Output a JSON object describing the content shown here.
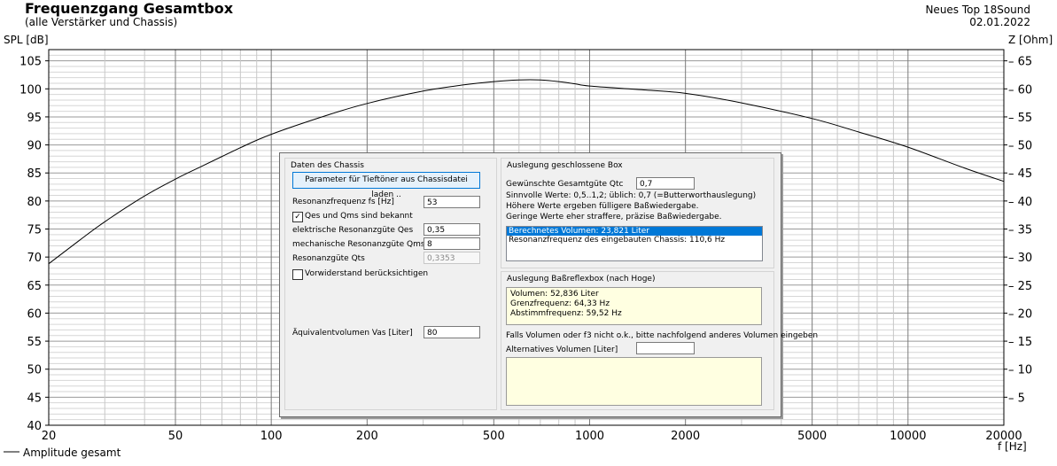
{
  "header": {
    "title": "Frequenzgang Gesamtbox",
    "subtitle": "(alle Verstärker und Chassis)",
    "project": "Neues Top 18Sound",
    "date": "02.01.2022"
  },
  "chart_data": {
    "type": "line",
    "title": "Frequenzgang Gesamtbox",
    "subtitle": "(alle Verstärker und Chassis)",
    "xlabel": "f [Hz]",
    "ylabel": "SPL [dB]",
    "y2label": "Z [Ohm]",
    "xscale": "log",
    "xlim": [
      20,
      20000
    ],
    "ylim": [
      40,
      107
    ],
    "y2lim": [
      0,
      67
    ],
    "grid": true,
    "x_ticks": [
      20,
      50,
      100,
      200,
      500,
      1000,
      2000,
      5000,
      10000,
      20000
    ],
    "x_tick_labels": [
      "20",
      "50",
      "100",
      "200",
      "500",
      "1000",
      "2000",
      "5000",
      "10000",
      "20000"
    ],
    "y_ticks": [
      40,
      45,
      50,
      55,
      60,
      65,
      70,
      75,
      80,
      85,
      90,
      95,
      100,
      105
    ],
    "y_tick_labels": [
      "40",
      "45",
      "50",
      "55",
      "60",
      "65",
      "70",
      "75",
      "80",
      "85",
      "90",
      "95",
      "100",
      "105"
    ],
    "y2_ticks": [
      5,
      10,
      15,
      20,
      25,
      30,
      35,
      40,
      45,
      50,
      55,
      60,
      65
    ],
    "y2_tick_labels": [
      "5",
      "10",
      "15",
      "20",
      "25",
      "30",
      "35",
      "40",
      "45",
      "50",
      "55",
      "60",
      "65"
    ],
    "legend": "bottom-left",
    "series": [
      {
        "name": "Amplitude gesamt",
        "color": "#000000",
        "x": [
          20,
          25,
          30,
          40,
          50,
          60,
          80,
          100,
          150,
          200,
          300,
          400,
          500,
          600,
          700,
          800,
          900,
          1000,
          1500,
          2000,
          3000,
          5000,
          7000,
          10000,
          15000,
          20000
        ],
        "y": [
          68.8,
          73.0,
          76.3,
          80.9,
          83.9,
          86.1,
          89.5,
          91.9,
          95.3,
          97.4,
          99.6,
          100.7,
          101.3,
          101.6,
          101.6,
          101.3,
          100.9,
          100.5,
          99.8,
          99.2,
          97.5,
          94.7,
          92.3,
          89.6,
          85.9,
          83.5
        ]
      }
    ]
  },
  "dialog": {
    "chassis_group": {
      "title": "Daten des Chassis",
      "load_button": "Parameter für Tieftöner aus Chassisdatei laden ..",
      "fs_label": "Resonanzfrequenz fs [Hz]",
      "fs_value": "53",
      "qes_qms_known_label": "Qes und Qms sind bekannt",
      "qes_qms_known_checked": true,
      "qes_label": "elektrische Resonanzgüte Qes",
      "qes_value": "0,35",
      "qms_label": "mechanische Resonanzgüte Qms",
      "qms_value": "8",
      "qts_label": "Resonanzgüte Qts",
      "qts_value": "0,3353",
      "resistor_label": "Vorwiderstand berücksichtigen",
      "resistor_checked": false,
      "vas_label": "Äquivalentvolumen Vas [Liter]",
      "vas_value": "80"
    },
    "closed_group": {
      "title": "Auslegung geschlossene Box",
      "qtc_label": "Gewünschte Gesamtgüte Qtc",
      "qtc_value": "0,7",
      "hint1": "Sinnvolle Werte: 0,5..1,2; üblich: 0,7 (=Butterworthauslegung)",
      "hint2": "Höhere Werte ergeben fülligere Baßwiedergabe.",
      "hint3": "Geringe Werte eher straffere, präzise Baßwiedergabe.",
      "result_selected": "Berechnetes Volumen: 23,821 Liter",
      "result_2": "Resonanzfrequenz des eingebauten Chassis: 110,6 Hz"
    },
    "reflex_group": {
      "title": "Auslegung Baßreflexbox (nach Hoge)",
      "volume": "Volumen: 52,836 Liter",
      "cutoff": "Grenzfrequenz: 64,33 Hz",
      "tuning": "Abstimmfrequenz: 59,52 Hz",
      "alt_hint": "Falls Volumen oder f3 nicht o.k., bitte nachfolgend anderes Volumen eingeben",
      "alt_label": "Alternatives Volumen [Liter]",
      "alt_value": ""
    }
  }
}
